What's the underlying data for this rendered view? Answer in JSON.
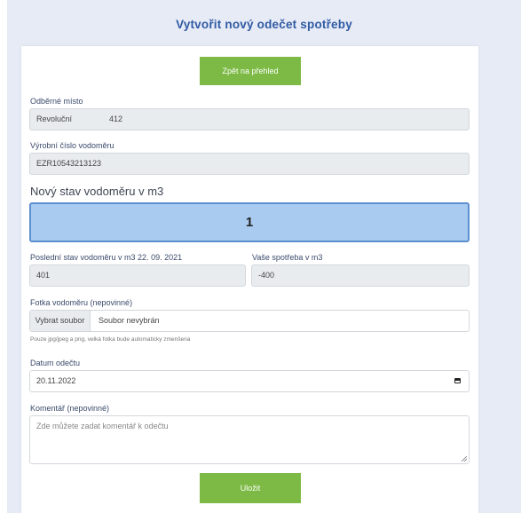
{
  "page": {
    "title": "Vytvořit nový odečet spotřeby",
    "back_button": "Zpět na přehled",
    "save_button": "Uložit"
  },
  "colors": {
    "accent_green": "#7cba45",
    "title_blue": "#2f5aa3",
    "highlight_field": "#a9cbf0",
    "background": "#e7ebf6"
  },
  "form": {
    "place": {
      "label": "Odběrné místo",
      "street": "Revoluční",
      "number": "412"
    },
    "serial": {
      "label": "Výrobní číslo vodoměru",
      "value": "EZR10543213123"
    },
    "new_state": {
      "label": "Nový stav vodoměru v m3",
      "value": "1"
    },
    "last_state": {
      "label": "Poslední stav vodoměru v m3 22. 09. 2021",
      "value": "401"
    },
    "consumption": {
      "label": "Vaše spotřeba v m3",
      "value": "-400"
    },
    "photo": {
      "label": "Fotka vodoměru (nepovinné)",
      "button": "Vybrat soubor",
      "filename": "Soubor nevybrán",
      "hint": "Pouze jpg/jpeg a png, velká fotka bude automaticky zmenšena"
    },
    "date": {
      "label": "Datum odečtu",
      "value": "20.11.2022",
      "icon": "calendar-icon"
    },
    "comment": {
      "label": "Komentář (nepovinné)",
      "placeholder": "Zde můžete zadat komentář k odečtu",
      "icon": "resize-handle-icon"
    }
  }
}
